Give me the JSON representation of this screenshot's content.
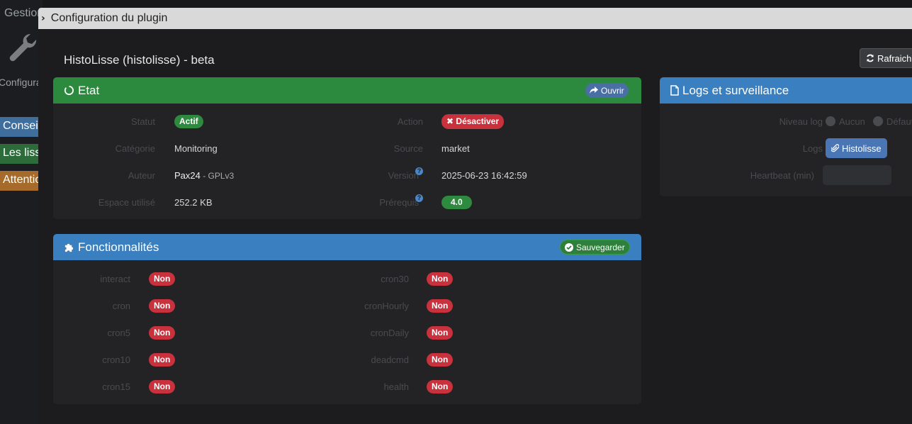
{
  "background": {
    "title": "Gestion",
    "config_label": "Configuration",
    "alerts": [
      "Conseil",
      "Les lissages",
      "Attention"
    ]
  },
  "modal": {
    "header_title": "Configuration du plugin",
    "plugin_title": "HistoLisse (histolisse) - beta",
    "refresh_label": "Rafraichir"
  },
  "etat": {
    "title": "Etat",
    "open_label": "Ouvrir",
    "fields": {
      "statut_label": "Statut",
      "statut_value": "Actif",
      "action_label": "Action",
      "action_value": "Désactiver",
      "categorie_label": "Catégorie",
      "categorie_value": "Monitoring",
      "source_label": "Source",
      "source_value": "market",
      "auteur_label": "Auteur",
      "auteur_name": "Pax24",
      "auteur_license": " - GPLv3",
      "version_label": "Version",
      "version_value": "2025-06-23 16:42:59",
      "espace_label": "Espace utilisé",
      "espace_value": "252.2 KB",
      "prerequis_label": "Prérequis",
      "prerequis_value": "4.0"
    }
  },
  "fonctionnalites": {
    "title": "Fonctionnalités",
    "save_label": "Sauvegarder",
    "left": [
      {
        "label": "interact",
        "value": "Non"
      },
      {
        "label": "cron",
        "value": "Non"
      },
      {
        "label": "cron5",
        "value": "Non"
      },
      {
        "label": "cron10",
        "value": "Non"
      },
      {
        "label": "cron15",
        "value": "Non"
      }
    ],
    "right": [
      {
        "label": "cron30",
        "value": "Non"
      },
      {
        "label": "cronHourly",
        "value": "Non"
      },
      {
        "label": "cronDaily",
        "value": "Non"
      },
      {
        "label": "deadcmd",
        "value": "Non"
      },
      {
        "label": "health",
        "value": "Non"
      }
    ]
  },
  "logs": {
    "title": "Logs et surveillance",
    "niveau_label": "Niveau log",
    "option_aucun": "Aucun",
    "option_defaut": "Défaut",
    "logs_label": "Logs",
    "logs_button": "Histolisse",
    "heartbeat_label": "Heartbeat (min)",
    "heartbeat_value": ""
  }
}
